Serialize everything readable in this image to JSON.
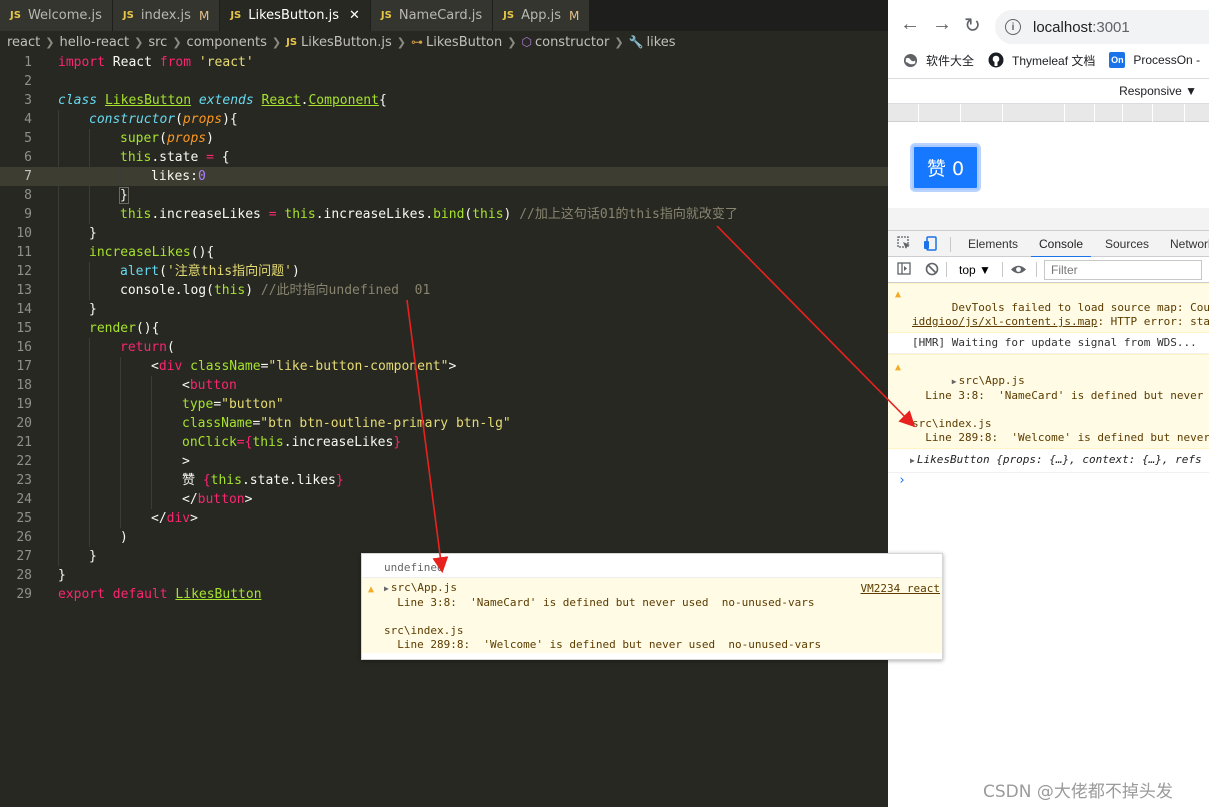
{
  "tabs": [
    {
      "label": "Welcome.js",
      "modified": "",
      "active": false
    },
    {
      "label": "index.js",
      "modified": "M",
      "active": false
    },
    {
      "label": "LikesButton.js",
      "modified": "",
      "active": true
    },
    {
      "label": "NameCard.js",
      "modified": "",
      "active": false
    },
    {
      "label": "App.js",
      "modified": "M",
      "active": false
    }
  ],
  "js_badge": "JS",
  "close_glyph": "✕",
  "breadcrumb": {
    "parts": [
      "react",
      "hello-react",
      "src",
      "components"
    ],
    "file": "LikesButton.js",
    "class": "LikesButton",
    "method": "constructor",
    "field": "likes"
  },
  "line_numbers": [
    "1",
    "2",
    "3",
    "4",
    "5",
    "6",
    "7",
    "8",
    "9",
    "10",
    "11",
    "12",
    "13",
    "14",
    "15",
    "16",
    "17",
    "18",
    "19",
    "20",
    "21",
    "22",
    "23",
    "24",
    "25",
    "26",
    "27",
    "28",
    "29"
  ],
  "code": {
    "l1": {
      "import": "import",
      "react": "React",
      "from": "from",
      "mod": "'react'"
    },
    "l3": {
      "class": "class",
      "name": "LikesButton",
      "extends": "extends",
      "react": "React",
      "dot": ".",
      "component": "Component",
      "brace": "{"
    },
    "l4": {
      "name": "constructor",
      "open": "(",
      "param": "props",
      "close": "){"
    },
    "l5": {
      "super": "super",
      "open": "(",
      "param": "props",
      "close": ")"
    },
    "l6": {
      "this": "this",
      "rest": ".state ",
      "eq": "=",
      "brace": " {"
    },
    "l7": {
      "text": "likes:",
      "num": "0"
    },
    "l8": {
      "text": "}"
    },
    "l9": {
      "this1": "this",
      "p1": ".increaseLikes ",
      "eq": "=",
      "this2": " this",
      "p2": ".increaseLikes.",
      "bind": "bind",
      "open": "(",
      "this3": "this",
      "close": ")",
      "comment": " //加上这句话01的this指向就改变了"
    },
    "l10": {
      "text": "}"
    },
    "l11": {
      "name": "increaseLikes",
      "rest": "(){"
    },
    "l12": {
      "alert": "alert",
      "open": "(",
      "str": "'注意this指向问题'",
      "close": ")"
    },
    "l13": {
      "console": "console.",
      "log": "log",
      "open": "(",
      "this": "this",
      "close": ")",
      "comment": " //此时指向undefined  01"
    },
    "l14": {
      "text": "}"
    },
    "l15": {
      "name": "render",
      "rest": "(){"
    },
    "l16": {
      "ret": "return",
      "open": "("
    },
    "l17": {
      "open": "<",
      "tag": "div",
      "attr": " className",
      "eq": "=",
      "val": "\"like-button-component\"",
      "close": ">"
    },
    "l18": {
      "open": "<",
      "tag": "button"
    },
    "l19": {
      "attr": "type",
      "eq": "=",
      "val": "\"button\""
    },
    "l20": {
      "attr": "className",
      "eq": "=",
      "val": "\"btn btn-outline-primary btn-lg\""
    },
    "l21": {
      "attr": "onClick",
      "eq": "=",
      "b1": "{",
      "this": "this",
      "rest": ".increaseLikes",
      "b2": "}"
    },
    "l22": {
      "text": ">"
    },
    "l23": {
      "zan": "赞 ",
      "b1": "{",
      "this": "this",
      "rest": ".state.likes",
      "b2": "}"
    },
    "l24": {
      "open": "</",
      "tag": "button",
      "close": ">"
    },
    "l25": {
      "open": "</",
      "tag": "div",
      "close": ">"
    },
    "l26": {
      "text": ")"
    },
    "l27": {
      "text": "}"
    },
    "l28": {
      "text": "}"
    },
    "l29": {
      "export": "export",
      "default": " default ",
      "name": "LikesButton"
    }
  },
  "browser": {
    "back": "←",
    "forward": "→",
    "reload": "↻",
    "info": "i",
    "url_host": "localhost",
    "url_port": ":3001",
    "bookmarks": [
      {
        "label": "软件大全",
        "icon": "globe-icon"
      },
      {
        "label": "Thymeleaf 文档",
        "icon": "github-icon"
      },
      {
        "label": "ProcessOn -",
        "icon": "processon-icon",
        "icon_text": "On"
      }
    ],
    "responsive": "Responsive ▼",
    "like_button": "赞 0"
  },
  "devtools": {
    "tabs": [
      "Elements",
      "Console",
      "Sources",
      "Network"
    ],
    "active_tab": "Console",
    "context": "top ▼",
    "filter_placeholder": "Filter",
    "messages": {
      "m1a": "DevTools failed to load source map: Could not",
      "m1b_link": "iddgioo/js/xl-content.js.map",
      "m1b_rest": ": HTTP error: sta",
      "m2": "[HMR] Waiting for update signal from WDS...",
      "m3a": "src\\App.js",
      "m3b": "  Line 3:8:  'NameCard' is defined but never",
      "m3c": "src\\index.js",
      "m3d": "  Line 289:8:  'Welcome' is defined but never",
      "m4_name": "LikesButton",
      "m4_rest": " {props: {…}, context: {…}, refs"
    },
    "prompt": "›"
  },
  "popup": {
    "undefined": "undefined",
    "l1": "src\\App.js",
    "l2": "  Line 3:8:  'NameCard' is defined but never used  no-unused-vars",
    "l3": "src\\index.js",
    "l4": "  Line 289:8:  'Welcome' is defined but never used  no-unused-vars",
    "link": "VM2234 react"
  },
  "watermark": "CSDN @大佬都不掉头发",
  "colors": {
    "arrow": "#e8211f",
    "like_button": "#1677ff",
    "editor_bg": "#272822",
    "warn_bg": "#fffbe5"
  }
}
